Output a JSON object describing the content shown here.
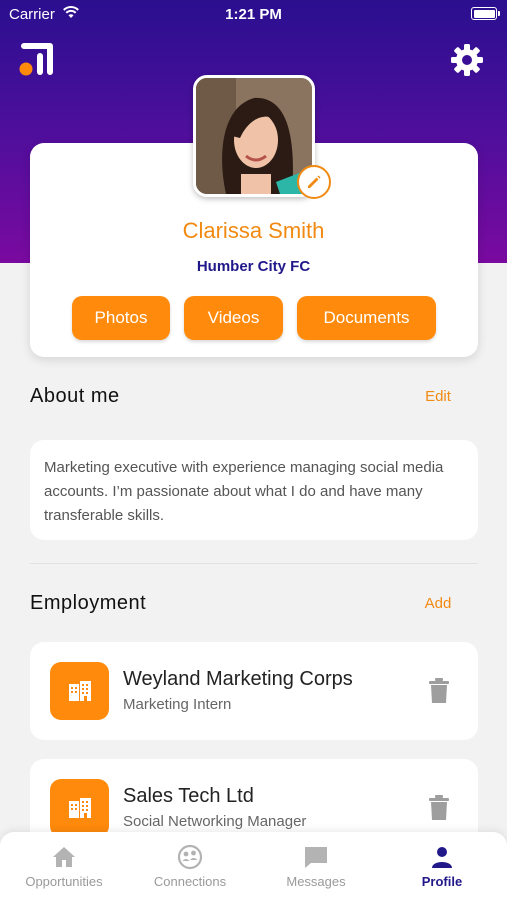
{
  "status": {
    "carrier": "Carrier",
    "time": "1:21 PM"
  },
  "profile": {
    "name": "Clarissa Smith",
    "club": "Humber City FC",
    "buttons": [
      {
        "label": "Photos"
      },
      {
        "label": "Videos"
      },
      {
        "label": "Documents"
      }
    ]
  },
  "about": {
    "title": "About me",
    "action": "Edit",
    "text": "Marketing executive with experience managing social media accounts. I’m passionate about what I do and have many transferable skills."
  },
  "employment": {
    "title": "Employment",
    "action": "Add",
    "jobs": [
      {
        "company": "Weyland Marketing Corps",
        "role": "Marketing Intern"
      },
      {
        "company": "Sales Tech Ltd",
        "role": "Social Networking Manager"
      }
    ]
  },
  "tabs": [
    {
      "label": "Opportunities",
      "icon": "home-icon"
    },
    {
      "label": "Connections",
      "icon": "connections-icon"
    },
    {
      "label": "Messages",
      "icon": "message-icon"
    },
    {
      "label": "Profile",
      "icon": "person-icon",
      "active": true
    }
  ],
  "colors": {
    "accent": "#ff8a0c",
    "brand_navy": "#21188a",
    "hero_top": "#2a0f8f",
    "hero_bottom": "#7a0aa0"
  }
}
